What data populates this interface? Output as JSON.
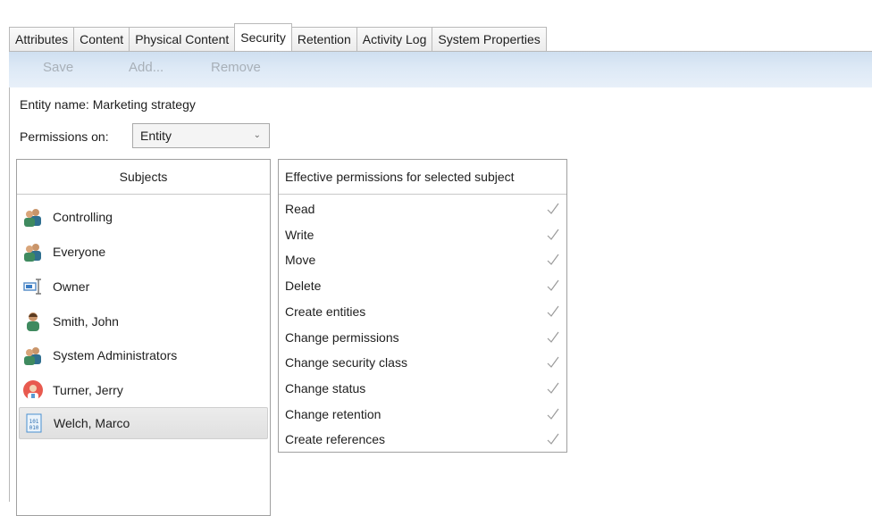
{
  "tabs": [
    {
      "label": "Attributes",
      "active": false
    },
    {
      "label": "Content",
      "active": false
    },
    {
      "label": "Physical Content",
      "active": false
    },
    {
      "label": "Security",
      "active": true
    },
    {
      "label": "Retention",
      "active": false
    },
    {
      "label": "Activity Log",
      "active": false
    },
    {
      "label": "System Properties",
      "active": false
    }
  ],
  "toolbar": {
    "save_label": "Save",
    "add_label": "Add...",
    "remove_label": "Remove"
  },
  "entity": {
    "label": "Entity name:",
    "value": "Marketing strategy"
  },
  "permissions_on": {
    "label": "Permissions on:",
    "selected": "Entity"
  },
  "subjects": {
    "header": "Subjects",
    "items": [
      {
        "name": "Controlling",
        "icon": "group-icon",
        "selected": false
      },
      {
        "name": "Everyone",
        "icon": "group-icon",
        "selected": false
      },
      {
        "name": "Owner",
        "icon": "owner-icon",
        "selected": false
      },
      {
        "name": "Smith, John",
        "icon": "user-icon",
        "selected": false
      },
      {
        "name": "System Administrators",
        "icon": "group-icon",
        "selected": false
      },
      {
        "name": "Turner, Jerry",
        "icon": "user-avatar-icon",
        "selected": false
      },
      {
        "name": "Welch, Marco",
        "icon": "binary-user-icon",
        "selected": true
      }
    ]
  },
  "permissions": {
    "header": "Effective permissions for selected subject",
    "items": [
      {
        "label": "Read",
        "granted": true
      },
      {
        "label": "Write",
        "granted": true
      },
      {
        "label": "Move",
        "granted": true
      },
      {
        "label": "Delete",
        "granted": true
      },
      {
        "label": "Create entities",
        "granted": true
      },
      {
        "label": "Change permissions",
        "granted": true
      },
      {
        "label": "Change security class",
        "granted": true
      },
      {
        "label": "Change status",
        "granted": true
      },
      {
        "label": "Change retention",
        "granted": true
      },
      {
        "label": "Create references",
        "granted": true
      }
    ]
  },
  "colors": {
    "toolbar_bg": "#dde9f6",
    "check": "#9a9a9a",
    "group_icon": "#3f8a5f"
  }
}
